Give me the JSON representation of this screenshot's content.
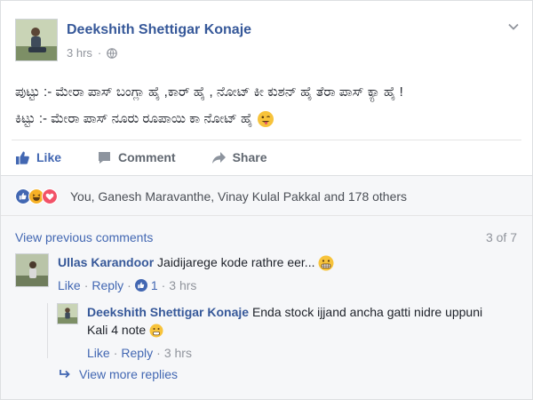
{
  "post": {
    "author": "Deekshith Shettigar Konaje",
    "time": "3 hrs",
    "lines": [
      "ಪುಟ್ಟು :- ಮೇರಾ ಪಾಸ್ ಬಂಗ್ಲಾ ಹೈ ,ಕಾರ್ ಹೈ , ನೋಟ್ ಕೀ ಕುಶನ್ ಹೈ ತೆರಾ ಪಾಸ್ ಕ್ಯಾ ಹೈ !",
      "ಕಿಟ್ಟು :- ಮೇರಾ ಪಾಸ್ ನೂರು ರೂಪಾಯಿ ಕಾ ನೋಟ್ ಹೈ"
    ],
    "actions": {
      "like": "Like",
      "comment": "Comment",
      "share": "Share"
    }
  },
  "reactions": {
    "summary": "You, Ganesh Maravanthe, Vinay Kulal Pakkal and 178 others",
    "types": [
      "like-icon",
      "haha-icon",
      "love-icon"
    ],
    "colors": {
      "like": "#4267b2",
      "haha": "#f7b125",
      "love": "#f25268"
    }
  },
  "comments": {
    "view_previous": "View previous comments",
    "count": "3 of 7",
    "items": [
      {
        "author": "Ullas Karandoor",
        "text": "Jaidijarege kode rathre eer...",
        "like": "Like",
        "reply": "Reply",
        "likes": "1",
        "time": "3 hrs"
      }
    ],
    "reply": {
      "author": "Deekshith Shettigar Konaje",
      "text": "Enda stock ijjand ancha gatti nidre uppuni Kali 4 note",
      "like": "Like",
      "reply": "Reply",
      "time": "3 hrs"
    },
    "view_more": "View more replies"
  },
  "colors": {
    "link": "#365899",
    "accent": "#4267b2",
    "meta": "#90949c"
  }
}
